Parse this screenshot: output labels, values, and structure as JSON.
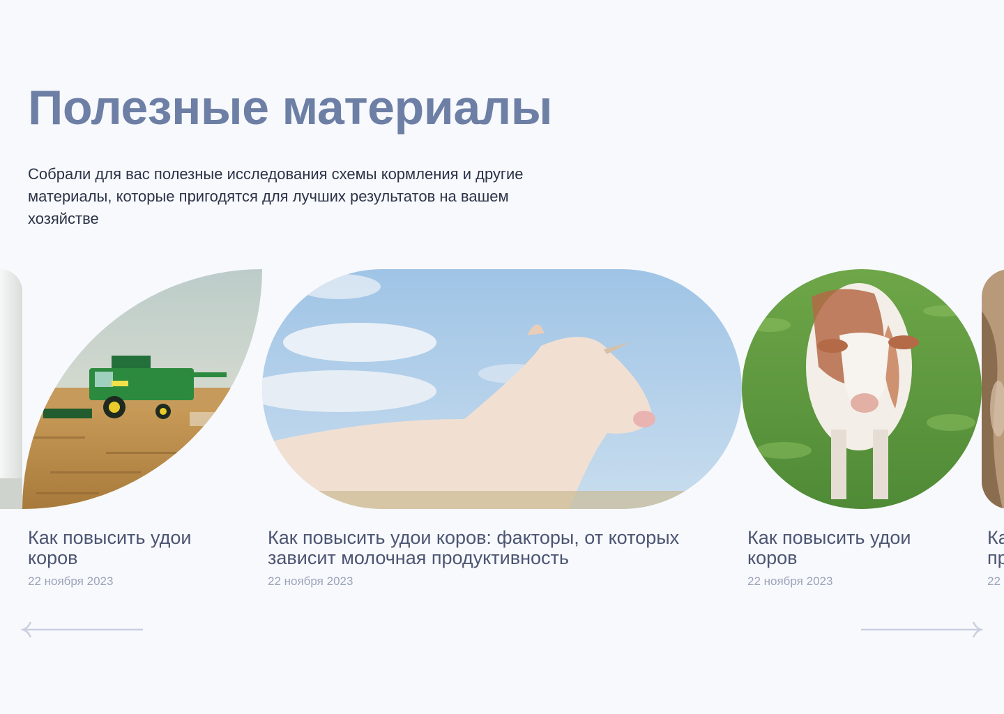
{
  "section": {
    "title": "Полезные материалы",
    "subtitle_lines": [
      "Собрали для вас полезные исследования схемы кормления и другие",
      "материалы, которые пригодятся для лучших результатов на вашем",
      "хозяйстве"
    ]
  },
  "cards": [
    {
      "title_lines": [
        "Как повысить удои",
        "коров"
      ],
      "date": "22 ноября 2023",
      "image": "combine-harvester-photo"
    },
    {
      "title_lines": [
        "Как повысить удои коров: факторы, от которых",
        "зависит молочная продуктивность"
      ],
      "date": "22 ноября 2023",
      "image": "white-cow-sky-photo"
    },
    {
      "title_lines": [
        "Как повысить удои",
        "коров"
      ],
      "date": "22 ноября 2023",
      "image": "spotted-cow-pasture-photo"
    },
    {
      "title_lines": [
        "Ка",
        "пр"
      ],
      "date": "22",
      "image": "cow-closeup-photo"
    }
  ],
  "navigation": {
    "prev_icon": "arrow-left-icon",
    "next_icon": "arrow-right-icon"
  },
  "colors": {
    "background": "#f8f9fd",
    "title": "#6d7fa5",
    "card_title": "#4c5572",
    "date": "#9aa3b8",
    "arrow": "#c9cfde"
  }
}
